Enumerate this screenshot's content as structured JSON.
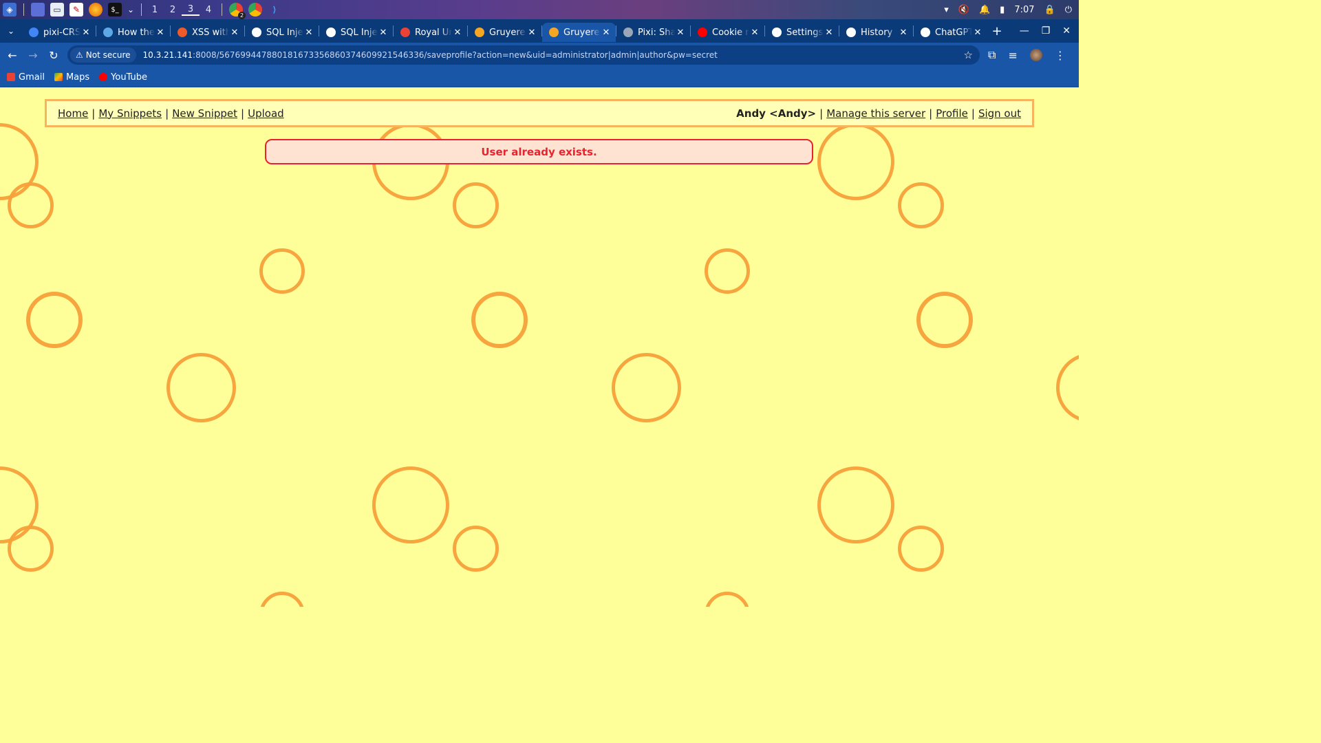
{
  "taskbar": {
    "workspaces": [
      "1",
      "2",
      "3",
      "4"
    ],
    "active_workspace": "3",
    "clock": "7:07",
    "badge_count": "2"
  },
  "tabs": [
    {
      "title": "pixi-CRS",
      "favicon": "google-icon",
      "color": "#4285f4"
    },
    {
      "title": "How the",
      "favicon": "site-icon",
      "color": "#5fa8e8"
    },
    {
      "title": "XSS with",
      "favicon": "site-icon",
      "color": "#f05a28"
    },
    {
      "title": "SQL Injec",
      "favicon": "site-icon",
      "color": "#ffffff"
    },
    {
      "title": "SQL Injec",
      "favicon": "site-icon",
      "color": "#ffffff"
    },
    {
      "title": "Royal Un",
      "favicon": "gmail-icon",
      "color": "#ea4335"
    },
    {
      "title": "Gruyere:",
      "favicon": "gruyere-icon",
      "color": "#f5a623"
    },
    {
      "title": "Gruyere:",
      "favicon": "gruyere-icon",
      "color": "#f5a623",
      "active": true
    },
    {
      "title": "Pixi: Shar",
      "favicon": "site-icon",
      "color": "#9aa7b8"
    },
    {
      "title": "Cookie m",
      "favicon": "youtube-icon",
      "color": "#ff0000"
    },
    {
      "title": "Settings",
      "favicon": "gear-icon",
      "color": "#ffffff"
    },
    {
      "title": "History",
      "favicon": "history-icon",
      "color": "#ffffff"
    },
    {
      "title": "ChatGPT",
      "favicon": "chatgpt-icon",
      "color": "#ffffff"
    }
  ],
  "omnibox": {
    "security_label": "Not secure",
    "url_host": "10.3.21.141",
    "url_rest": ":8008/567699447880181673356860374609921546336/saveprofile?action=new&uid=administrator|admin|author&pw=secret"
  },
  "bookmarks": [
    {
      "label": "Gmail",
      "icon": "gmail-icon",
      "color": "#ea4335"
    },
    {
      "label": "Maps",
      "icon": "maps-icon",
      "color": "#34a853"
    },
    {
      "label": "YouTube",
      "icon": "youtube-icon",
      "color": "#ff0000"
    }
  ],
  "menu": {
    "home": "Home",
    "my_snippets": "My Snippets",
    "new_snippet": "New Snippet",
    "upload": "Upload",
    "user": "Andy <Andy>",
    "manage": "Manage this server",
    "profile": "Profile",
    "sign_out": "Sign out",
    "separator": "|"
  },
  "message": "User already exists.",
  "colors": {
    "page_bg": "#ffff99",
    "circle": "#f7a03a",
    "error": "#e8222e",
    "error_bg": "#ffe3d2",
    "chrome_blue": "#1a56a8"
  }
}
